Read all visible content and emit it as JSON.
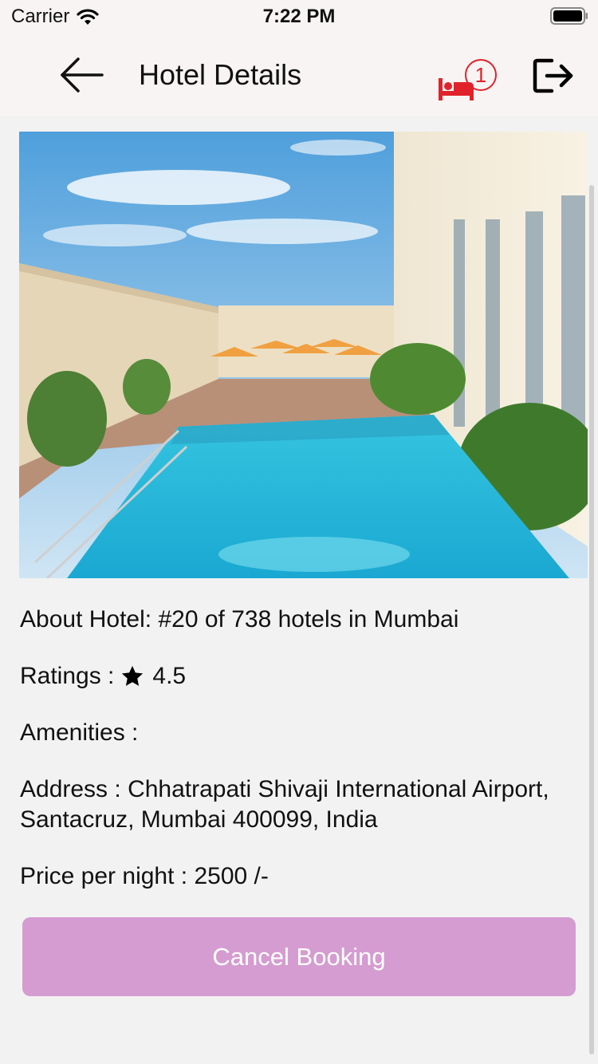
{
  "status_bar": {
    "carrier": "Carrier",
    "time": "7:22 PM"
  },
  "nav": {
    "title": "Hotel Details",
    "bookings_badge": "1",
    "accent_color": "#e0232a"
  },
  "hotel": {
    "about_label": "About Hotel:",
    "about_value": "#20 of 738 hotels in Mumbai",
    "ratings_label": "Ratings :",
    "rating_value": "4.5",
    "amenities_label": "Amenities :",
    "address_label": "Address :",
    "address_value": "Chhatrapati Shivaji International Airport, Santacruz, Mumbai 400099, India",
    "price_label": "Price per night :",
    "price_value": "2500 /-"
  },
  "actions": {
    "cancel_label": "Cancel Booking",
    "cancel_color": "#d59cd1"
  },
  "icons": [
    "wifi-icon",
    "battery-icon",
    "back-arrow-icon",
    "bed-icon",
    "logout-icon",
    "star-icon"
  ]
}
